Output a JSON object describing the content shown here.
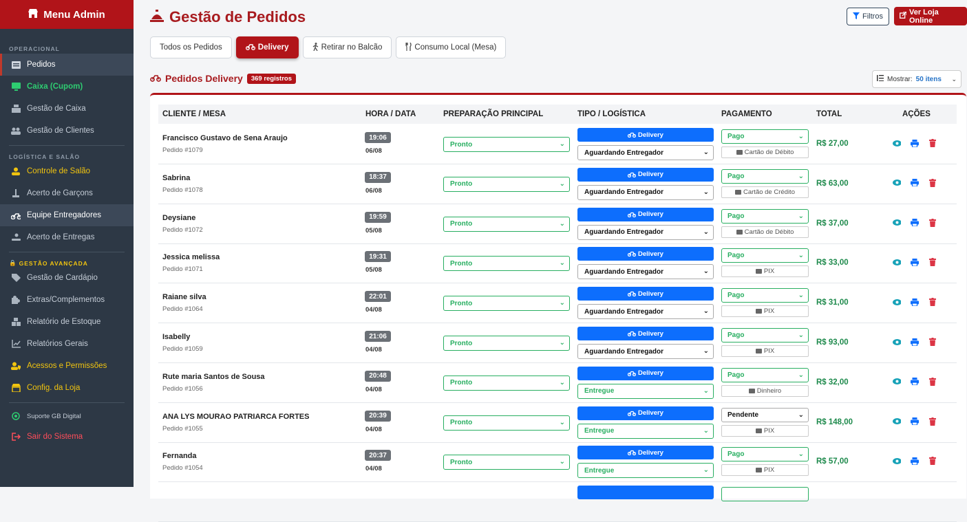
{
  "sidebar": {
    "title": "Menu Admin",
    "sec_operacional": "OPERACIONAL",
    "sec_logistica": "LOGÍSTICA E SALÃO",
    "sec_gestao": "GESTÃO AVANÇADA",
    "items": [
      {
        "label": "Pedidos"
      },
      {
        "label": "Caixa (Cupom)"
      },
      {
        "label": "Gestão de Caixa"
      },
      {
        "label": "Gestão de Clientes"
      },
      {
        "label": "Controle de Salão"
      },
      {
        "label": "Acerto de Garçons"
      },
      {
        "label": "Equipe Entregadores"
      },
      {
        "label": "Acerto de Entregas"
      },
      {
        "label": "Gestão de Cardápio"
      },
      {
        "label": "Extras/Complementos"
      },
      {
        "label": "Relatório de Estoque"
      },
      {
        "label": "Relatórios Gerais"
      },
      {
        "label": "Acessos e Permissões"
      },
      {
        "label": "Config. da Loja"
      },
      {
        "label": "Suporte GB Digital"
      },
      {
        "label": "Sair do Sistema"
      }
    ]
  },
  "header": {
    "title": "Gestão de Pedidos",
    "filter_label": "Filtros",
    "store_label": "Ver Loja Online"
  },
  "tabs": [
    {
      "label": "Todos os Pedidos"
    },
    {
      "label": "Delivery"
    },
    {
      "label": "Retirar no Balcão"
    },
    {
      "label": "Consumo Local (Mesa)"
    }
  ],
  "section": {
    "title": "Pedidos Delivery",
    "count": "369 registros",
    "show_label": "Mostrar:",
    "show_value": "50 itens"
  },
  "table": {
    "headers": [
      "CLIENTE / MESA",
      "HORA / DATA",
      "PREPARAÇÃO PRINCIPAL",
      "TIPO / LOGÍSTICA",
      "PAGAMENTO",
      "TOTAL",
      "AÇÕES"
    ],
    "delivery_label": "Delivery",
    "rows": [
      {
        "name": "Francisco Gustavo de Sena Araujo",
        "order": "Pedido #1079",
        "time": "19:06",
        "date": "06/08",
        "prep": "Pronto",
        "logistics": "Aguardando Entregador",
        "payment": "Pago",
        "method": "Cartão de Débito",
        "total": "R$ 27,00"
      },
      {
        "name": "Sabrina",
        "order": "Pedido #1078",
        "time": "18:37",
        "date": "06/08",
        "prep": "Pronto",
        "logistics": "Aguardando Entregador",
        "payment": "Pago",
        "method": "Cartão de Crédito",
        "total": "R$ 63,00"
      },
      {
        "name": "Deysiane",
        "order": "Pedido #1072",
        "time": "19:59",
        "date": "05/08",
        "prep": "Pronto",
        "logistics": "Aguardando Entregador",
        "payment": "Pago",
        "method": "Cartão de Débito",
        "total": "R$ 37,00"
      },
      {
        "name": "Jessica melissa",
        "order": "Pedido #1071",
        "time": "19:31",
        "date": "05/08",
        "prep": "Pronto",
        "logistics": "Aguardando Entregador",
        "payment": "Pago",
        "method": "PIX",
        "total": "R$ 33,00"
      },
      {
        "name": "Raiane silva",
        "order": "Pedido #1064",
        "time": "22:01",
        "date": "04/08",
        "prep": "Pronto",
        "logistics": "Aguardando Entregador",
        "payment": "Pago",
        "method": "PIX",
        "total": "R$ 31,00"
      },
      {
        "name": "Isabelly",
        "order": "Pedido #1059",
        "time": "21:06",
        "date": "04/08",
        "prep": "Pronto",
        "logistics": "Aguardando Entregador",
        "payment": "Pago",
        "method": "PIX",
        "total": "R$ 93,00"
      },
      {
        "name": "Rute maria Santos de Sousa",
        "order": "Pedido #1056",
        "time": "20:48",
        "date": "04/08",
        "prep": "Pronto",
        "logistics": "Entregue",
        "payment": "Pago",
        "method": "Dinheiro",
        "total": "R$ 32,00"
      },
      {
        "name": "ANA LYS MOURAO PATRIARCA FORTES",
        "order": "Pedido #1055",
        "time": "20:39",
        "date": "04/08",
        "prep": "Pronto",
        "logistics": "Entregue",
        "payment": "Pendente",
        "method": "PIX",
        "total": "R$ 148,00"
      },
      {
        "name": "Fernanda",
        "order": "Pedido #1054",
        "time": "20:37",
        "date": "04/08",
        "prep": "Pronto",
        "logistics": "Entregue",
        "payment": "Pago",
        "method": "PIX",
        "total": "R$ 57,00"
      }
    ]
  },
  "colors": {
    "brand": "#b11419",
    "delivery": "#0d6efd",
    "success": "#27ae60"
  }
}
